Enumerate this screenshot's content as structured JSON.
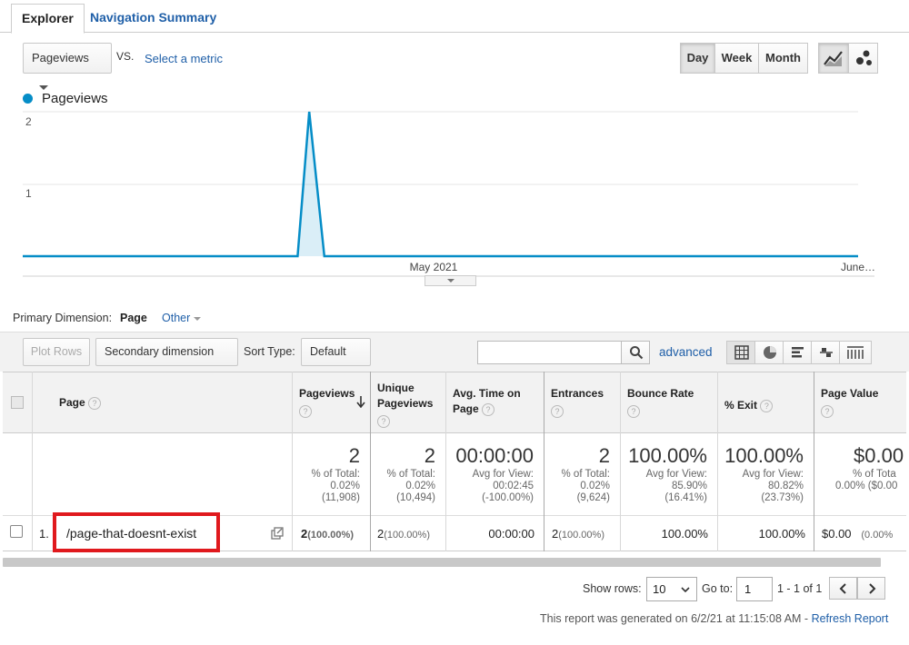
{
  "tabs": {
    "explorer": "Explorer",
    "navigation_summary": "Navigation Summary"
  },
  "metric_bar": {
    "metric": "Pageviews",
    "vs": "VS.",
    "select_metric": "Select a metric"
  },
  "period_buttons": {
    "day": "Day",
    "week": "Week",
    "month": "Month",
    "selected": "Day"
  },
  "chart_data": {
    "type": "area",
    "series": [
      {
        "name": "Pageviews",
        "color": "#058dc7"
      }
    ],
    "x_tick_labels": [
      "May 2021",
      "June…"
    ],
    "y_tick_labels": [
      "2",
      "1"
    ],
    "ylim": [
      0,
      2
    ],
    "points": [
      {
        "x": 0,
        "y": 0
      },
      {
        "x": 0.329,
        "y": 0
      },
      {
        "x": 0.343,
        "y": 2
      },
      {
        "x": 0.361,
        "y": 0
      },
      {
        "x": 1,
        "y": 0
      }
    ],
    "grid": true
  },
  "dimension_bar": {
    "label": "Primary Dimension:",
    "selected": "Page",
    "other": "Other"
  },
  "toolbar": {
    "plot_rows": "Plot Rows",
    "secondary_dimension": "Secondary dimension",
    "sort_type_label": "Sort Type:",
    "sort_type_value": "Default",
    "search_value": "",
    "advanced": "advanced"
  },
  "table": {
    "headers": {
      "page": "Page",
      "pageviews": "Pageviews",
      "unique_pageviews_1": "Unique",
      "unique_pageviews_2": "Pageviews",
      "avg_time_1": "Avg. Time on",
      "avg_time_2": "Page",
      "entrances": "Entrances",
      "bounce_rate": "Bounce Rate",
      "exit": "% Exit",
      "page_value": "Page Value"
    },
    "totals": {
      "pageviews": {
        "value": "2",
        "l1": "% of Total:",
        "l2": "0.02%",
        "l3": "(11,908)"
      },
      "unique": {
        "value": "2",
        "l1": "% of Total:",
        "l2": "0.02%",
        "l3": "(10,494)"
      },
      "avg_time": {
        "value": "00:00:00",
        "l1": "Avg for View:",
        "l2": "00:02:45",
        "l3": "(-100.00%)"
      },
      "entrances": {
        "value": "2",
        "l1": "% of Total:",
        "l2": "0.02%",
        "l3": "(9,624)"
      },
      "bounce": {
        "value": "100.00%",
        "l1": "Avg for View:",
        "l2": "85.90%",
        "l3": "(16.41%)"
      },
      "exit": {
        "value": "100.00%",
        "l1": "Avg for View:",
        "l2": "80.82%",
        "l3": "(23.73%)"
      },
      "page_value": {
        "value": "$0.00",
        "l1": "% of Tota",
        "l2": "0.00% ($0.00"
      }
    },
    "rows": [
      {
        "index": "1.",
        "page": "/page-that-doesnt-exist",
        "pageviews": "2",
        "pageviews_pct": "(100.00%)",
        "unique": "2",
        "unique_pct": "(100.00%)",
        "avg_time": "00:00:00",
        "entrances": "2",
        "entrances_pct": "(100.00%)",
        "bounce": "100.00%",
        "exit": "100.00%",
        "page_value": "$0.00",
        "page_value_pct": "(0.00%"
      }
    ]
  },
  "footer": {
    "show_rows_label": "Show rows:",
    "show_rows_value": "10",
    "goto_label": "Go to:",
    "goto_value": "1",
    "range": "1 - 1 of 1",
    "generated": "This report was generated on 6/2/21 at 11:15:08 AM - ",
    "refresh": "Refresh Report"
  },
  "colors": {
    "accent": "#1f5fa8",
    "highlight": "#e0191d",
    "series": "#058dc7"
  }
}
